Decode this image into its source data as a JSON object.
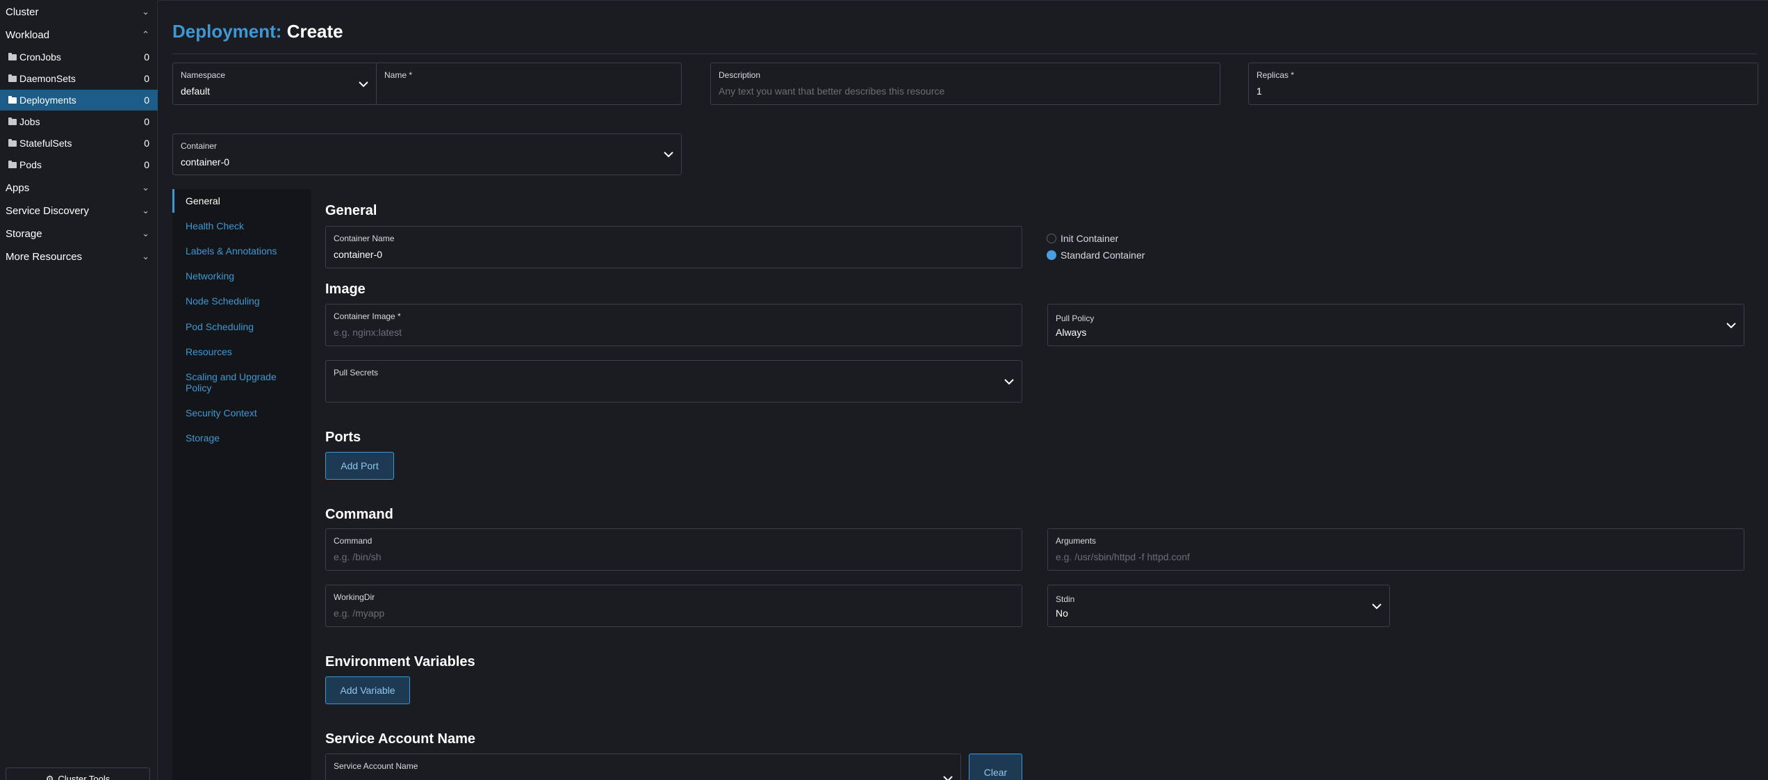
{
  "sidebar": {
    "groups": [
      {
        "label": "Cluster",
        "expanded": false
      },
      {
        "label": "Workload",
        "expanded": true
      },
      {
        "label": "Apps",
        "expanded": false
      },
      {
        "label": "Service Discovery",
        "expanded": false
      },
      {
        "label": "Storage",
        "expanded": false
      },
      {
        "label": "More Resources",
        "expanded": false
      }
    ],
    "workload_items": [
      {
        "label": "CronJobs",
        "count": "0"
      },
      {
        "label": "DaemonSets",
        "count": "0"
      },
      {
        "label": "Deployments",
        "count": "0"
      },
      {
        "label": "Jobs",
        "count": "0"
      },
      {
        "label": "StatefulSets",
        "count": "0"
      },
      {
        "label": "Pods",
        "count": "0"
      }
    ],
    "active_item": "Deployments",
    "cluster_tools_label": "Cluster Tools"
  },
  "header": {
    "resource": "Deployment:",
    "action": "Create"
  },
  "top_fields": {
    "namespace": {
      "label": "Namespace",
      "value": "default"
    },
    "name": {
      "label": "Name *",
      "value": ""
    },
    "description": {
      "label": "Description",
      "placeholder": "Any text you want that better describes this resource"
    },
    "replicas": {
      "label": "Replicas *",
      "value": "1"
    }
  },
  "container_select": {
    "label": "Container",
    "value": "container-0"
  },
  "tabs": [
    "General",
    "Health Check",
    "Labels & Annotations",
    "Networking",
    "Node Scheduling",
    "Pod Scheduling",
    "Resources",
    "Scaling and Upgrade Policy",
    "Security Context",
    "Storage"
  ],
  "general": {
    "heading": "General",
    "container_name": {
      "label": "Container Name",
      "value": "container-0"
    },
    "container_type": {
      "options": [
        "Init Container",
        "Standard Container"
      ],
      "selected": "Standard Container"
    }
  },
  "image": {
    "heading": "Image",
    "container_image": {
      "label": "Container Image *",
      "placeholder": "e.g. nginx:latest"
    },
    "pull_policy": {
      "label": "Pull Policy",
      "value": "Always"
    },
    "pull_secrets": {
      "label": "Pull Secrets",
      "value": ""
    }
  },
  "ports": {
    "heading": "Ports",
    "add_label": "Add Port"
  },
  "command": {
    "heading": "Command",
    "command": {
      "label": "Command",
      "placeholder": "e.g. /bin/sh"
    },
    "arguments": {
      "label": "Arguments",
      "placeholder": "e.g. /usr/sbin/httpd -f httpd.conf"
    },
    "workingdir": {
      "label": "WorkingDir",
      "placeholder": "e.g. /myapp"
    },
    "stdin": {
      "label": "Stdin",
      "value": "No"
    }
  },
  "env": {
    "heading": "Environment Variables",
    "add_label": "Add Variable"
  },
  "service_account": {
    "heading": "Service Account Name",
    "label": "Service Account Name",
    "clear_label": "Clear"
  },
  "colors": {
    "accent": "#3d98d3",
    "active_nav": "#1d5b88",
    "background": "#1b1c21"
  }
}
